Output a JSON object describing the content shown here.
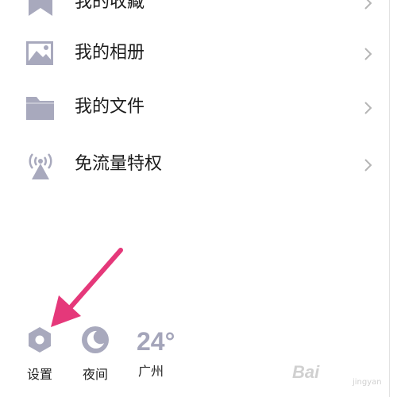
{
  "menu": {
    "items": [
      {
        "label": "我的收藏",
        "icon": "bookmark-icon"
      },
      {
        "label": "我的相册",
        "icon": "image-icon"
      },
      {
        "label": "我的文件",
        "icon": "folder-icon"
      },
      {
        "label": "免流量特权",
        "icon": "signal-tower-icon"
      }
    ]
  },
  "bottom_bar": {
    "settings_label": "设置",
    "night_label": "夜间",
    "weather": {
      "temperature": "24°",
      "city": "广州"
    }
  },
  "colors": {
    "icon": "#a8a9bd",
    "arrow": "#e5387a",
    "chevron": "#b5b5b5"
  },
  "watermark": {
    "text": "Bai",
    "subtext": "jingyan"
  }
}
